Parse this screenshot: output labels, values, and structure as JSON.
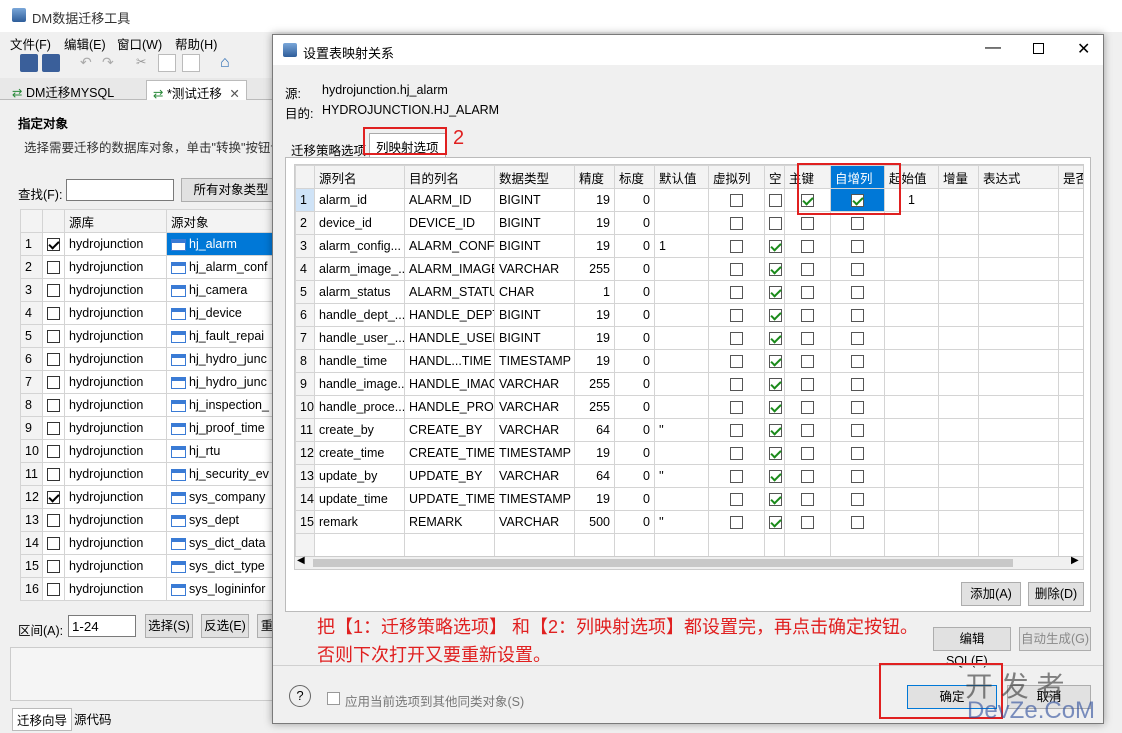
{
  "main": {
    "title": "DM数据迁移工具",
    "menu": [
      "文件(F)",
      "编辑(E)",
      "窗口(W)",
      "帮助(H)"
    ],
    "tabs": [
      "DM迁移MYSQL",
      "*测试迁移"
    ],
    "section_title": "指定对象",
    "section_desc": "选择需要迁移的数据库对象，单击\"转换\"按钮设",
    "find_label": "查找(F):",
    "all_types": "所有对象类型",
    "col_source_db": "源库",
    "col_source_obj": "源对象",
    "rows": [
      {
        "n": "1",
        "db": "hydrojunction",
        "obj": "hj_alarm",
        "checked": true,
        "selected": true
      },
      {
        "n": "2",
        "db": "hydrojunction",
        "obj": "hj_alarm_conf",
        "checked": false
      },
      {
        "n": "3",
        "db": "hydrojunction",
        "obj": "hj_camera",
        "checked": false
      },
      {
        "n": "4",
        "db": "hydrojunction",
        "obj": "hj_device",
        "checked": false
      },
      {
        "n": "5",
        "db": "hydrojunction",
        "obj": "hj_fault_repai",
        "checked": false
      },
      {
        "n": "6",
        "db": "hydrojunction",
        "obj": "hj_hydro_junc",
        "checked": false
      },
      {
        "n": "7",
        "db": "hydrojunction",
        "obj": "hj_hydro_junc",
        "checked": false
      },
      {
        "n": "8",
        "db": "hydrojunction",
        "obj": "hj_inspection_",
        "checked": false
      },
      {
        "n": "9",
        "db": "hydrojunction",
        "obj": "hj_proof_time",
        "checked": false
      },
      {
        "n": "10",
        "db": "hydrojunction",
        "obj": "hj_rtu",
        "checked": false
      },
      {
        "n": "11",
        "db": "hydrojunction",
        "obj": "hj_security_ev",
        "checked": false
      },
      {
        "n": "12",
        "db": "hydrojunction",
        "obj": "sys_company",
        "checked": true
      },
      {
        "n": "13",
        "db": "hydrojunction",
        "obj": "sys_dept",
        "checked": false
      },
      {
        "n": "14",
        "db": "hydrojunction",
        "obj": "sys_dict_data",
        "checked": false
      },
      {
        "n": "15",
        "db": "hydrojunction",
        "obj": "sys_dict_type",
        "checked": false
      },
      {
        "n": "16",
        "db": "hydrojunction",
        "obj": "sys_logininfor",
        "checked": false
      }
    ],
    "range_label": "区间(A):",
    "range_value": "1-24",
    "select_btn": "选择(S)",
    "invert_btn": "反选(E)",
    "bottom_tabs": [
      "迁移向导",
      "源代码"
    ]
  },
  "dialog": {
    "title": "设置表映射关系",
    "source_label": "源:",
    "source_value": "hydrojunction.hj_alarm",
    "target_label": "目的:",
    "target_value": "HYDROJUNCTION.HJ_ALARM",
    "tab_strategy": "迁移策略选项",
    "tab_mapping": "列映射选项",
    "marker2": "2",
    "headers": [
      "源列名",
      "目的列名",
      "数据类型",
      "精度",
      "标度",
      "默认值",
      "虚拟列",
      "空",
      "主键",
      "自增列",
      "起始值",
      "增量",
      "表达式",
      "是否"
    ],
    "rows": [
      {
        "n": "1",
        "src": "alarm_id",
        "dst": "ALARM_ID",
        "type": "BIGINT",
        "prec": "19",
        "scale": "0",
        "def": "",
        "virt": false,
        "nullable": false,
        "pk": true,
        "ai": true,
        "start": "1"
      },
      {
        "n": "2",
        "src": "device_id",
        "dst": "DEVICE_ID",
        "type": "BIGINT",
        "prec": "19",
        "scale": "0",
        "def": "",
        "virt": false,
        "nullable": false,
        "pk": false,
        "ai": false,
        "start": ""
      },
      {
        "n": "3",
        "src": "alarm_config...",
        "dst": "ALARM_CONFI",
        "type": "BIGINT",
        "prec": "19",
        "scale": "0",
        "def": "1",
        "virt": false,
        "nullable": true,
        "pk": false,
        "ai": false,
        "start": ""
      },
      {
        "n": "4",
        "src": "alarm_image_...",
        "dst": "ALARM_IMAGE",
        "type": "VARCHAR",
        "prec": "255",
        "scale": "0",
        "def": "",
        "virt": false,
        "nullable": true,
        "pk": false,
        "ai": false,
        "start": ""
      },
      {
        "n": "5",
        "src": "alarm_status",
        "dst": "ALARM_STATU",
        "type": "CHAR",
        "prec": "1",
        "scale": "0",
        "def": "",
        "virt": false,
        "nullable": true,
        "pk": false,
        "ai": false,
        "start": ""
      },
      {
        "n": "6",
        "src": "handle_dept_...",
        "dst": "HANDLE_DEPT_",
        "type": "BIGINT",
        "prec": "19",
        "scale": "0",
        "def": "",
        "virt": false,
        "nullable": true,
        "pk": false,
        "ai": false,
        "start": ""
      },
      {
        "n": "7",
        "src": "handle_user_...",
        "dst": "HANDLE_USER",
        "type": "BIGINT",
        "prec": "19",
        "scale": "0",
        "def": "",
        "virt": false,
        "nullable": true,
        "pk": false,
        "ai": false,
        "start": ""
      },
      {
        "n": "8",
        "src": "handle_time",
        "dst": "HANDL...TIME",
        "type": "TIMESTAMP",
        "prec": "19",
        "scale": "0",
        "def": "",
        "virt": false,
        "nullable": true,
        "pk": false,
        "ai": false,
        "start": ""
      },
      {
        "n": "9",
        "src": "handle_image...",
        "dst": "HANDLE_IMAG",
        "type": "VARCHAR",
        "prec": "255",
        "scale": "0",
        "def": "",
        "virt": false,
        "nullable": true,
        "pk": false,
        "ai": false,
        "start": ""
      },
      {
        "n": "10",
        "src": "handle_proce...",
        "dst": "HANDLE_PROC",
        "type": "VARCHAR",
        "prec": "255",
        "scale": "0",
        "def": "",
        "virt": false,
        "nullable": true,
        "pk": false,
        "ai": false,
        "start": ""
      },
      {
        "n": "11",
        "src": "create_by",
        "dst": "CREATE_BY",
        "type": "VARCHAR",
        "prec": "64",
        "scale": "0",
        "def": "''",
        "virt": false,
        "nullable": true,
        "pk": false,
        "ai": false,
        "start": ""
      },
      {
        "n": "12",
        "src": "create_time",
        "dst": "CREATE_TIME",
        "type": "TIMESTAMP",
        "prec": "19",
        "scale": "0",
        "def": "",
        "virt": false,
        "nullable": true,
        "pk": false,
        "ai": false,
        "start": ""
      },
      {
        "n": "13",
        "src": "update_by",
        "dst": "UPDATE_BY",
        "type": "VARCHAR",
        "prec": "64",
        "scale": "0",
        "def": "''",
        "virt": false,
        "nullable": true,
        "pk": false,
        "ai": false,
        "start": ""
      },
      {
        "n": "14",
        "src": "update_time",
        "dst": "UPDATE_TIME",
        "type": "TIMESTAMP",
        "prec": "19",
        "scale": "0",
        "def": "",
        "virt": false,
        "nullable": true,
        "pk": false,
        "ai": false,
        "start": ""
      },
      {
        "n": "15",
        "src": "remark",
        "dst": "REMARK",
        "type": "VARCHAR",
        "prec": "500",
        "scale": "0",
        "def": "''",
        "virt": false,
        "nullable": true,
        "pk": false,
        "ai": false,
        "start": ""
      }
    ],
    "add_btn": "添加(A)",
    "delete_btn": "删除(D)",
    "edit_sql_btn": "编辑SQL(E)...",
    "auto_gen_btn": "自动生成(G)",
    "annotation_line1": "把【1：迁移策略选项】 和【2：列映射选项】都设置完，再点击确定按钮。",
    "annotation_line2": "否则下次打开又要重新设置。",
    "apply_label": "应用当前选项到其他同类对象(S)",
    "ok_btn": "确定",
    "cancel_btn": "取消",
    "watermark1": "开 发 者",
    "watermark2": "DevZe.CoM"
  },
  "colors": {
    "accent": "#0078d7",
    "annotation": "#e02020"
  }
}
